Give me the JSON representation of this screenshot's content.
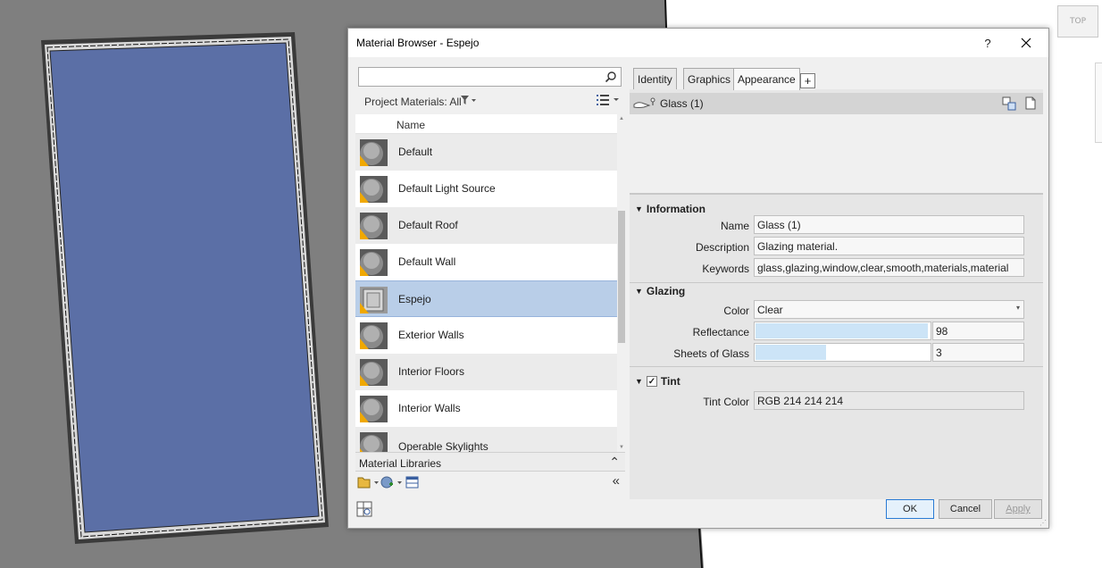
{
  "viewport": {
    "view_cube_label": "TOP",
    "colors": {
      "background": "#7f7f7f",
      "glass_panel": "#5b6fa6",
      "paper": "#ffffff"
    }
  },
  "dialog": {
    "title": "Material Browser - Espejo",
    "help_label": "?",
    "close_icon": "close-icon"
  },
  "search": {
    "value": "",
    "placeholder": ""
  },
  "project_materials": {
    "filter_label": "Project Materials: All",
    "column_header": "Name",
    "items": [
      {
        "label": "Default"
      },
      {
        "label": "Default Light Source"
      },
      {
        "label": "Default Roof"
      },
      {
        "label": "Default Wall"
      },
      {
        "label": "Espejo",
        "selected": true
      },
      {
        "label": "Exterior Walls"
      },
      {
        "label": "Interior Floors"
      },
      {
        "label": "Interior Walls"
      },
      {
        "label": "Operable Skylights"
      }
    ]
  },
  "libraries": {
    "label": "Material Libraries"
  },
  "tabs": [
    {
      "label": "Identity"
    },
    {
      "label": "Graphics"
    },
    {
      "label": "Appearance",
      "active": true
    }
  ],
  "tab_add_label": "+",
  "asset": {
    "name": "Glass (1)"
  },
  "information": {
    "heading": "Information",
    "name_label": "Name",
    "name_value": "Glass (1)",
    "description_label": "Description",
    "description_value": "Glazing material.",
    "keywords_label": "Keywords",
    "keywords_value": "glass,glazing,window,clear,smooth,materials,material"
  },
  "glazing": {
    "heading": "Glazing",
    "color_label": "Color",
    "color_value": "Clear",
    "reflectance_label": "Reflectance",
    "reflectance_value": "98",
    "reflectance_fill_fraction": 0.98,
    "sheets_label": "Sheets of Glass",
    "sheets_value": "3",
    "sheets_fill_fraction": 0.4
  },
  "tint": {
    "heading": "Tint",
    "enabled": true,
    "color_label": "Tint Color",
    "color_value": "RGB 214 214 214"
  },
  "footer": {
    "ok_label": "OK",
    "cancel_label": "Cancel",
    "apply_label": "Apply"
  }
}
